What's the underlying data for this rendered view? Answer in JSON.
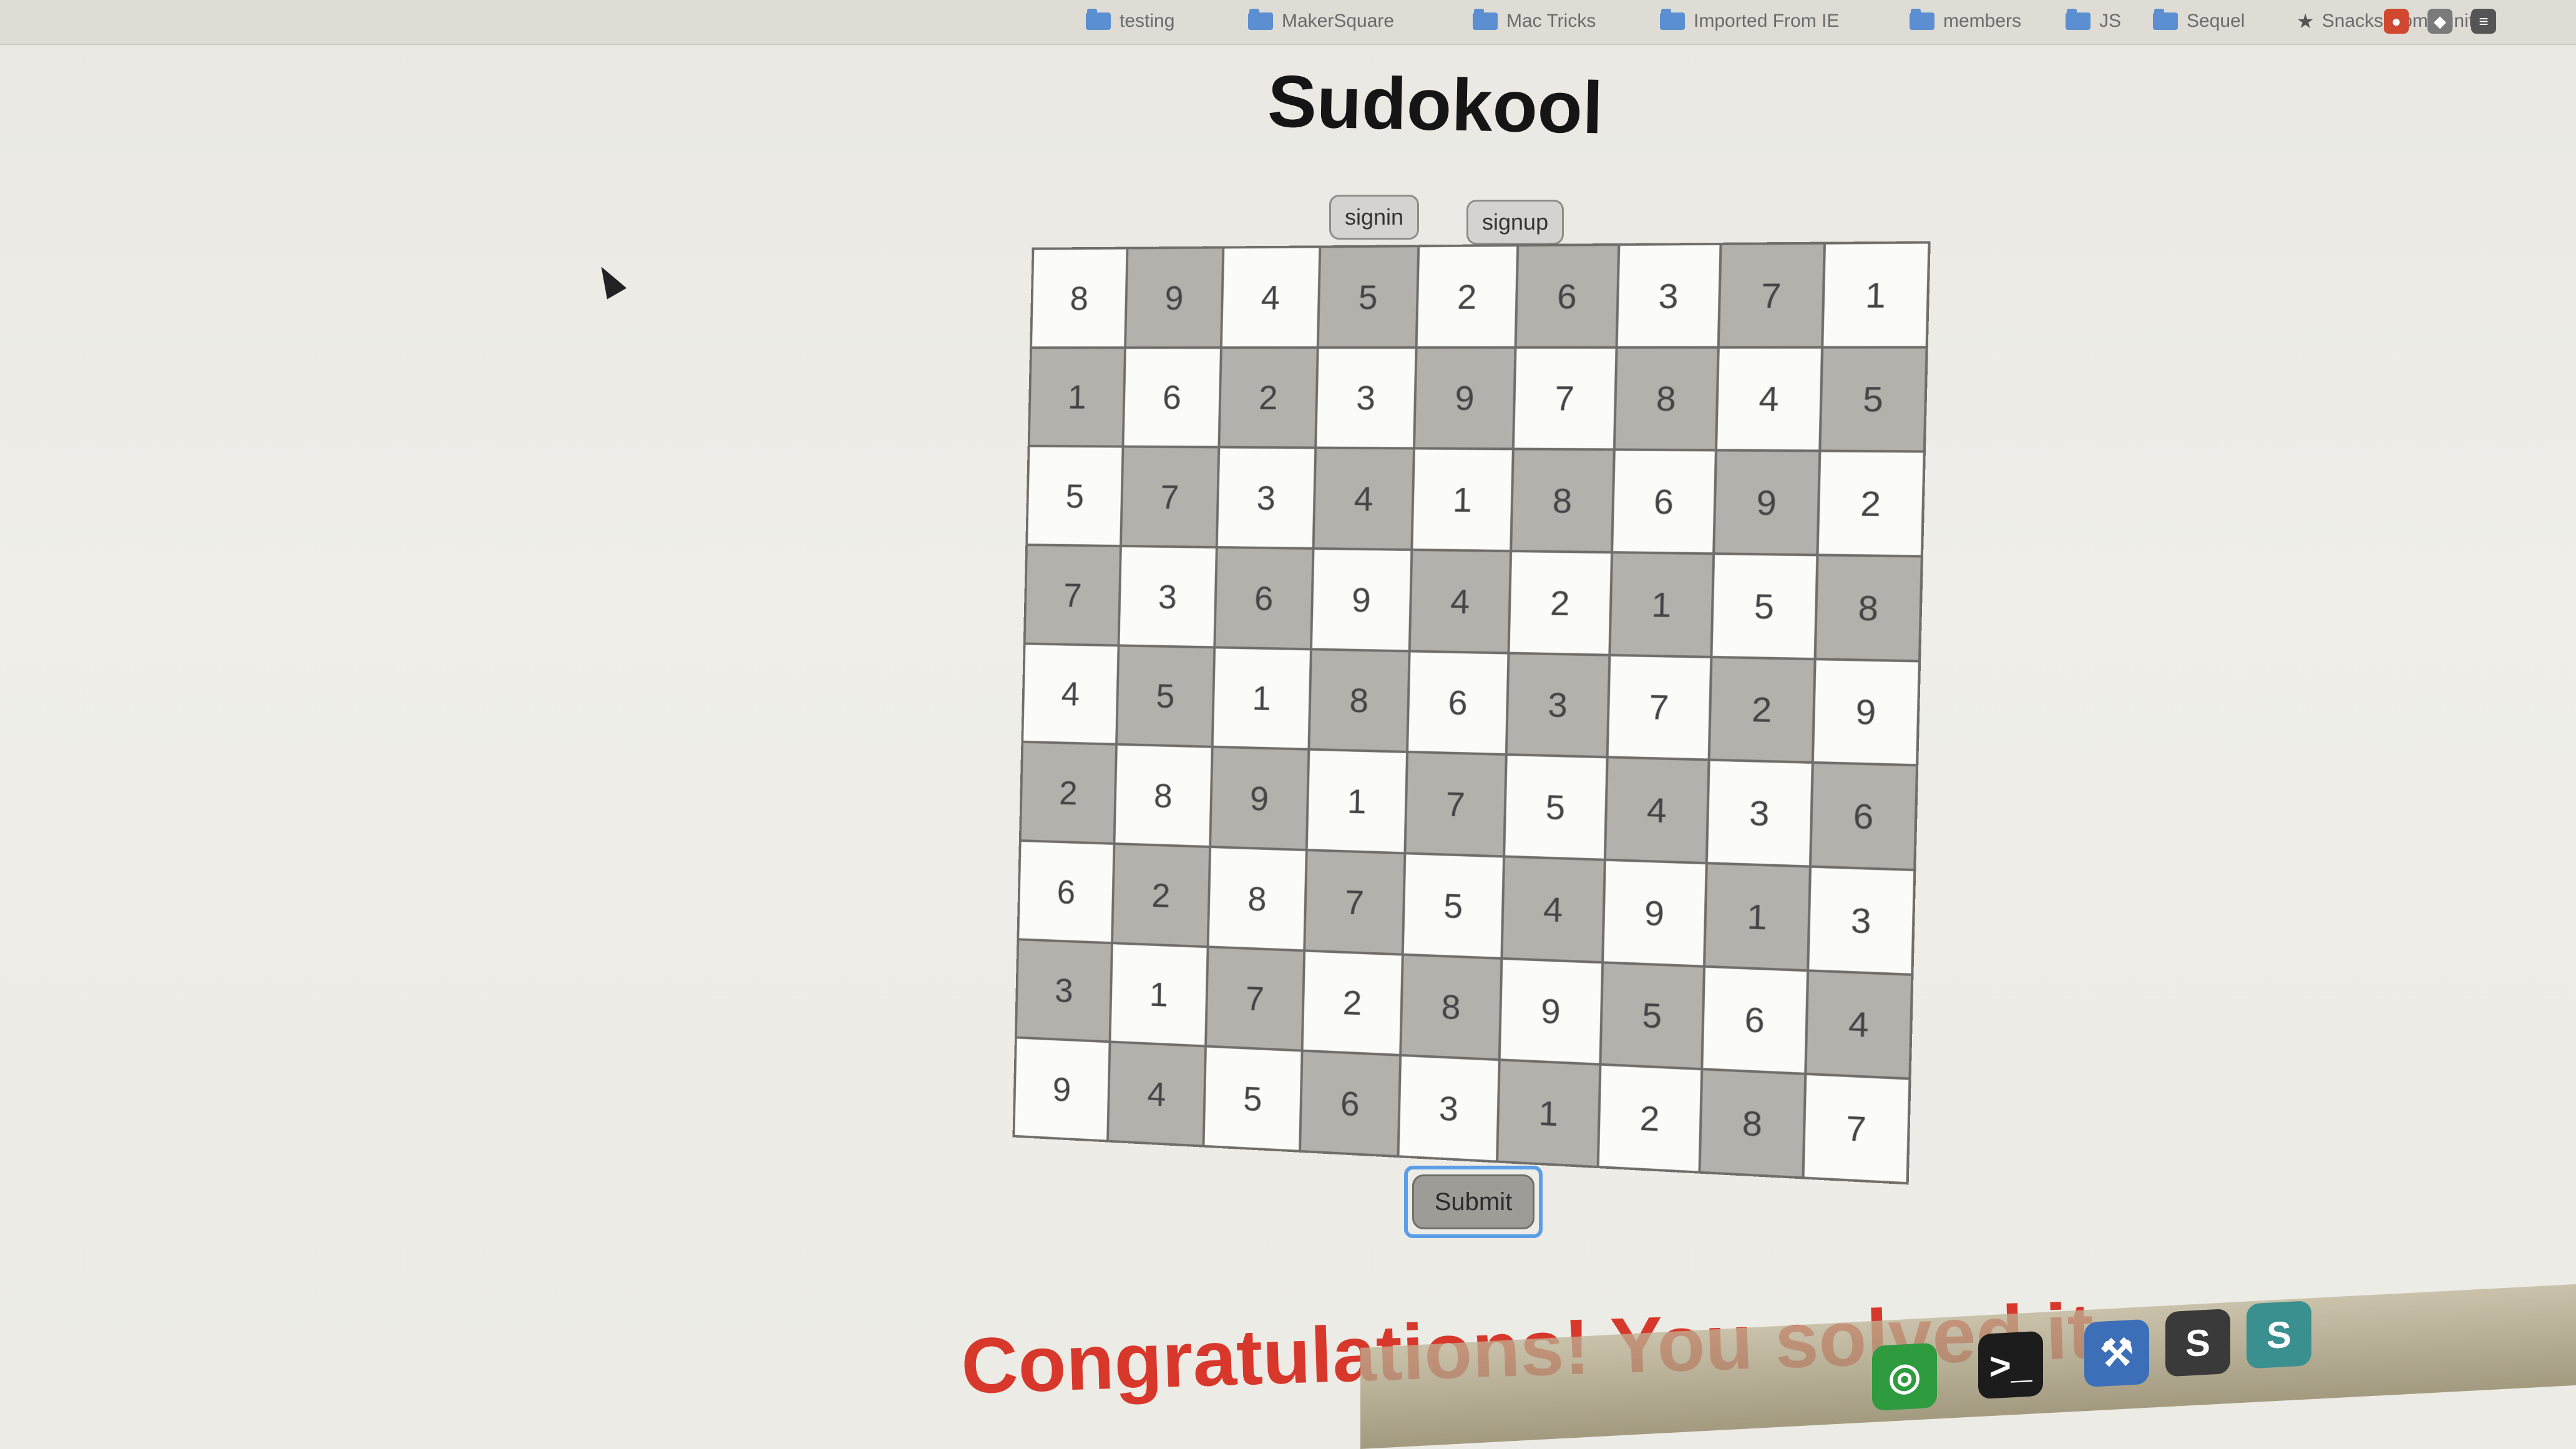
{
  "browser": {
    "bookmarks": [
      {
        "label": "testing",
        "icon": "folder-icon"
      },
      {
        "label": "MakerSquare",
        "icon": "folder-icon"
      },
      {
        "label": "Mac Tricks",
        "icon": "folder-icon"
      },
      {
        "label": "Imported From IE",
        "icon": "folder-icon"
      },
      {
        "label": "members",
        "icon": "folder-icon"
      },
      {
        "label": "JS",
        "icon": "folder-icon"
      },
      {
        "label": "Sequel",
        "icon": "folder-icon"
      },
      {
        "label": "Snacks Community",
        "icon": "star-icon"
      }
    ]
  },
  "page": {
    "title": "Sudokool",
    "signin_label": "signin",
    "signup_label": "signup",
    "submit_label": "Submit",
    "message": "Congratulations! You solved it.",
    "message_color": "#d8372b"
  },
  "board": {
    "rows": [
      [
        8,
        9,
        4,
        5,
        2,
        6,
        3,
        7,
        1
      ],
      [
        1,
        6,
        2,
        3,
        9,
        7,
        8,
        4,
        5
      ],
      [
        5,
        7,
        3,
        4,
        1,
        8,
        6,
        9,
        2
      ],
      [
        7,
        3,
        6,
        9,
        4,
        2,
        1,
        5,
        8
      ],
      [
        4,
        5,
        1,
        8,
        6,
        3,
        7,
        2,
        9
      ],
      [
        2,
        8,
        9,
        1,
        7,
        5,
        4,
        3,
        6
      ],
      [
        6,
        2,
        8,
        7,
        5,
        4,
        9,
        1,
        3
      ],
      [
        3,
        1,
        7,
        2,
        8,
        9,
        5,
        6,
        4
      ],
      [
        9,
        4,
        5,
        6,
        3,
        1,
        2,
        8,
        7
      ]
    ],
    "light_color": "#fbfbf8",
    "dark_color": "#b2b1ac"
  },
  "dock": {
    "apps": [
      {
        "icon": "chrome-icon",
        "color": "#2e9b3f"
      },
      {
        "icon": "terminal-icon",
        "color": "#1c1c1c"
      },
      {
        "icon": "xcode-icon",
        "color": "#3d6fb8"
      },
      {
        "icon": "sublime-text-icon",
        "color": "#3a3a3a"
      },
      {
        "icon": "s-app-icon",
        "color": "#3a8f8f"
      }
    ]
  }
}
